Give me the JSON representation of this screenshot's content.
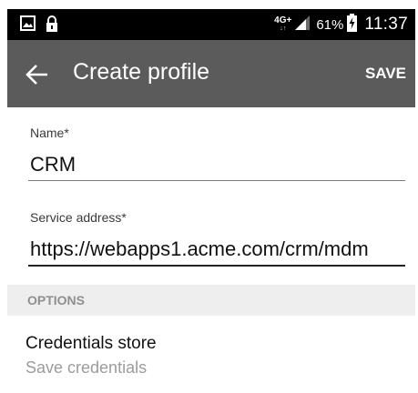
{
  "status_bar": {
    "network_type": "4G+",
    "network_activity": "↓↑",
    "battery_percent": "61%",
    "time": "11:37",
    "icons": [
      "image-icon",
      "lock-icon",
      "signal-icon",
      "battery-charging-icon"
    ]
  },
  "app_bar": {
    "title": "Create profile",
    "save_label": "SAVE",
    "back_icon": "arrow-left-icon",
    "background_color": "#5b5b5b"
  },
  "form": {
    "name": {
      "label": "Name*",
      "value": "CRM"
    },
    "service_address": {
      "label": "Service address*",
      "value": "https://webapps1.acme.com/crm/mdm"
    }
  },
  "options": {
    "header": "OPTIONS",
    "items": [
      {
        "title": "Credentials store",
        "summary": "Save credentials"
      }
    ]
  }
}
